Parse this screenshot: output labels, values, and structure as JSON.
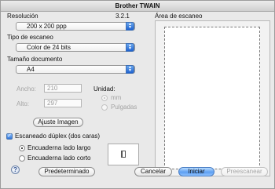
{
  "window": {
    "title": "Brother TWAIN"
  },
  "resolution": {
    "label": "Resolución",
    "version": "3.2.1",
    "selected": "200 x 200 ppp"
  },
  "scan_type": {
    "label": "Tipo de escaneo",
    "selected": "Color de 24 bits"
  },
  "doc_size": {
    "label": "Tamaño documento",
    "selected": "A4"
  },
  "dimensions": {
    "width_label": "Ancho:",
    "width_value": "210",
    "height_label": "Alto:",
    "height_value": "297",
    "unit_label": "Unidad:",
    "unit_mm": "mm",
    "unit_inches": "Pulgadas",
    "selected_unit": "mm"
  },
  "buttons": {
    "adjust": "Ajuste Imagen",
    "default": "Predeterminado",
    "cancel": "Cancelar",
    "start": "Iniciar",
    "prescan": "Preescanear"
  },
  "duplex": {
    "label": "Escaneado dúplex (dos caras)",
    "checked": true,
    "long_edge": "Encuaderna lado largo",
    "short_edge": "Encuaderna lado corto",
    "selected": "long_edge"
  },
  "preview": {
    "label": "Área de escaneo"
  },
  "help": {
    "glyph": "?"
  },
  "icons": {
    "popup_arrows": "up-down-arrows-icon",
    "help": "help-icon",
    "checkmark": "checkmark-icon",
    "duplex": "duplex-binding-icon"
  }
}
